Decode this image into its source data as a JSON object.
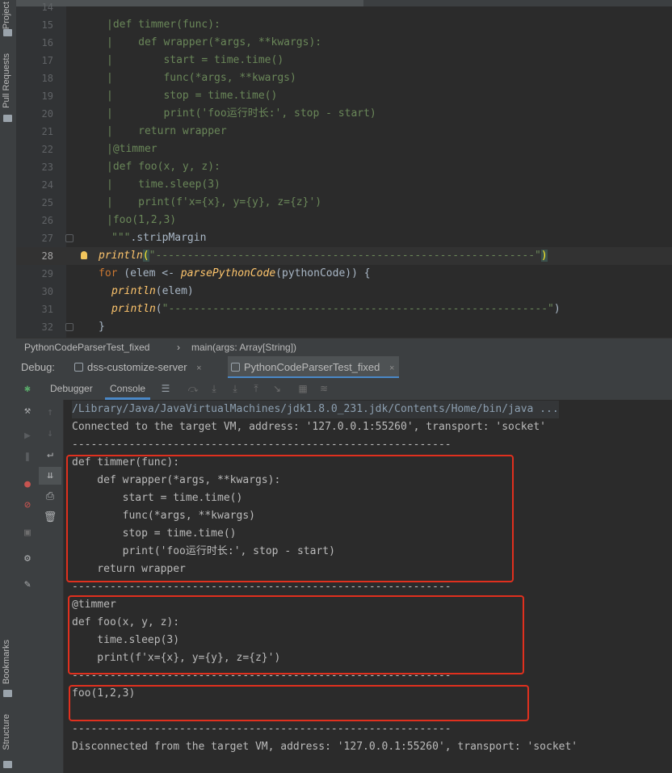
{
  "sidebar": {
    "project_label": "Project",
    "pull_requests_label": "Pull Requests",
    "bookmarks_label": "Bookmarks",
    "structure_label": "Structure"
  },
  "editor": {
    "lines": [
      {
        "num": "14",
        "text": ""
      },
      {
        "num": "15",
        "text": "|def timmer(func):"
      },
      {
        "num": "16",
        "text": "|    def wrapper(*args, **kwargs):"
      },
      {
        "num": "17",
        "text": "|        start = time.time()"
      },
      {
        "num": "18",
        "text": "|        func(*args, **kwargs)"
      },
      {
        "num": "19",
        "text": "|        stop = time.time()"
      },
      {
        "num": "20",
        "text": "|        print('foo运行时长:', stop - start)"
      },
      {
        "num": "21",
        "text": "|    return wrapper"
      },
      {
        "num": "22",
        "text": "|@timmer"
      },
      {
        "num": "23",
        "text": "|def foo(x, y, z):"
      },
      {
        "num": "24",
        "text": "|    time.sleep(3)"
      },
      {
        "num": "25",
        "text": "|    print(f'x={x}, y={y}, z={z}')"
      },
      {
        "num": "26",
        "text": "|foo(1,2,3)"
      },
      {
        "num": "27",
        "text": "\"\"\""
      },
      {
        "num": "28",
        "text": ""
      },
      {
        "num": "29",
        "text": ""
      },
      {
        "num": "30",
        "text": ""
      },
      {
        "num": "31",
        "text": ""
      },
      {
        "num": "32",
        "text": "}"
      }
    ],
    "line27_suffix": ".stripMargin",
    "line28": {
      "fn": "println",
      "open": "(",
      "str": "\"------------------------------------------------------------\"",
      "close": ")"
    },
    "line29": {
      "kw": "for",
      "rest1": " (elem <- ",
      "fn": "parsePythonCode",
      "rest2": "(pythonCode)) {"
    },
    "line30": {
      "fn": "println",
      "rest": "(elem)"
    },
    "line31": {
      "fn": "println",
      "open": "(",
      "str": "\"------------------------------------------------------------\"",
      "close": ")"
    }
  },
  "breadcrumb": {
    "item1": "PythonCodeParserTest_fixed",
    "sep": "›",
    "item2": "main(args: Array[String])"
  },
  "debug": {
    "label": "Debug:",
    "tabs": [
      {
        "label": "dss-customize-server",
        "close": "×"
      },
      {
        "label": "PythonCodeParserTest_fixed",
        "close": "×"
      }
    ],
    "subtabs": [
      "Debugger",
      "Console"
    ]
  },
  "console": {
    "cmd_line": "/Library/Java/JavaVirtualMachines/jdk1.8.0_231.jdk/Contents/Home/bin/java ...",
    "lines": [
      "Connected to the target VM, address: '127.0.0.1:55260', transport: 'socket'",
      "------------------------------------------------------------",
      "def timmer(func):",
      "    def wrapper(*args, **kwargs):",
      "        start = time.time()",
      "        func(*args, **kwargs)",
      "        stop = time.time()",
      "        print('foo运行时长:', stop - start)",
      "    return wrapper",
      "------------------------------------------------------------",
      "@timmer",
      "def foo(x, y, z):",
      "    time.sleep(3)",
      "    print(f'x={x}, y={y}, z={z}')",
      "------------------------------------------------------------",
      "foo(1,2,3)",
      "",
      "------------------------------------------------------------",
      "Disconnected from the target VM, address: '127.0.0.1:55260', transport: 'socket'"
    ]
  },
  "colors": {
    "annotation_box": "#e0301e",
    "accent": "#4a88c7",
    "string": "#6a8759",
    "keyword": "#cc7832"
  }
}
